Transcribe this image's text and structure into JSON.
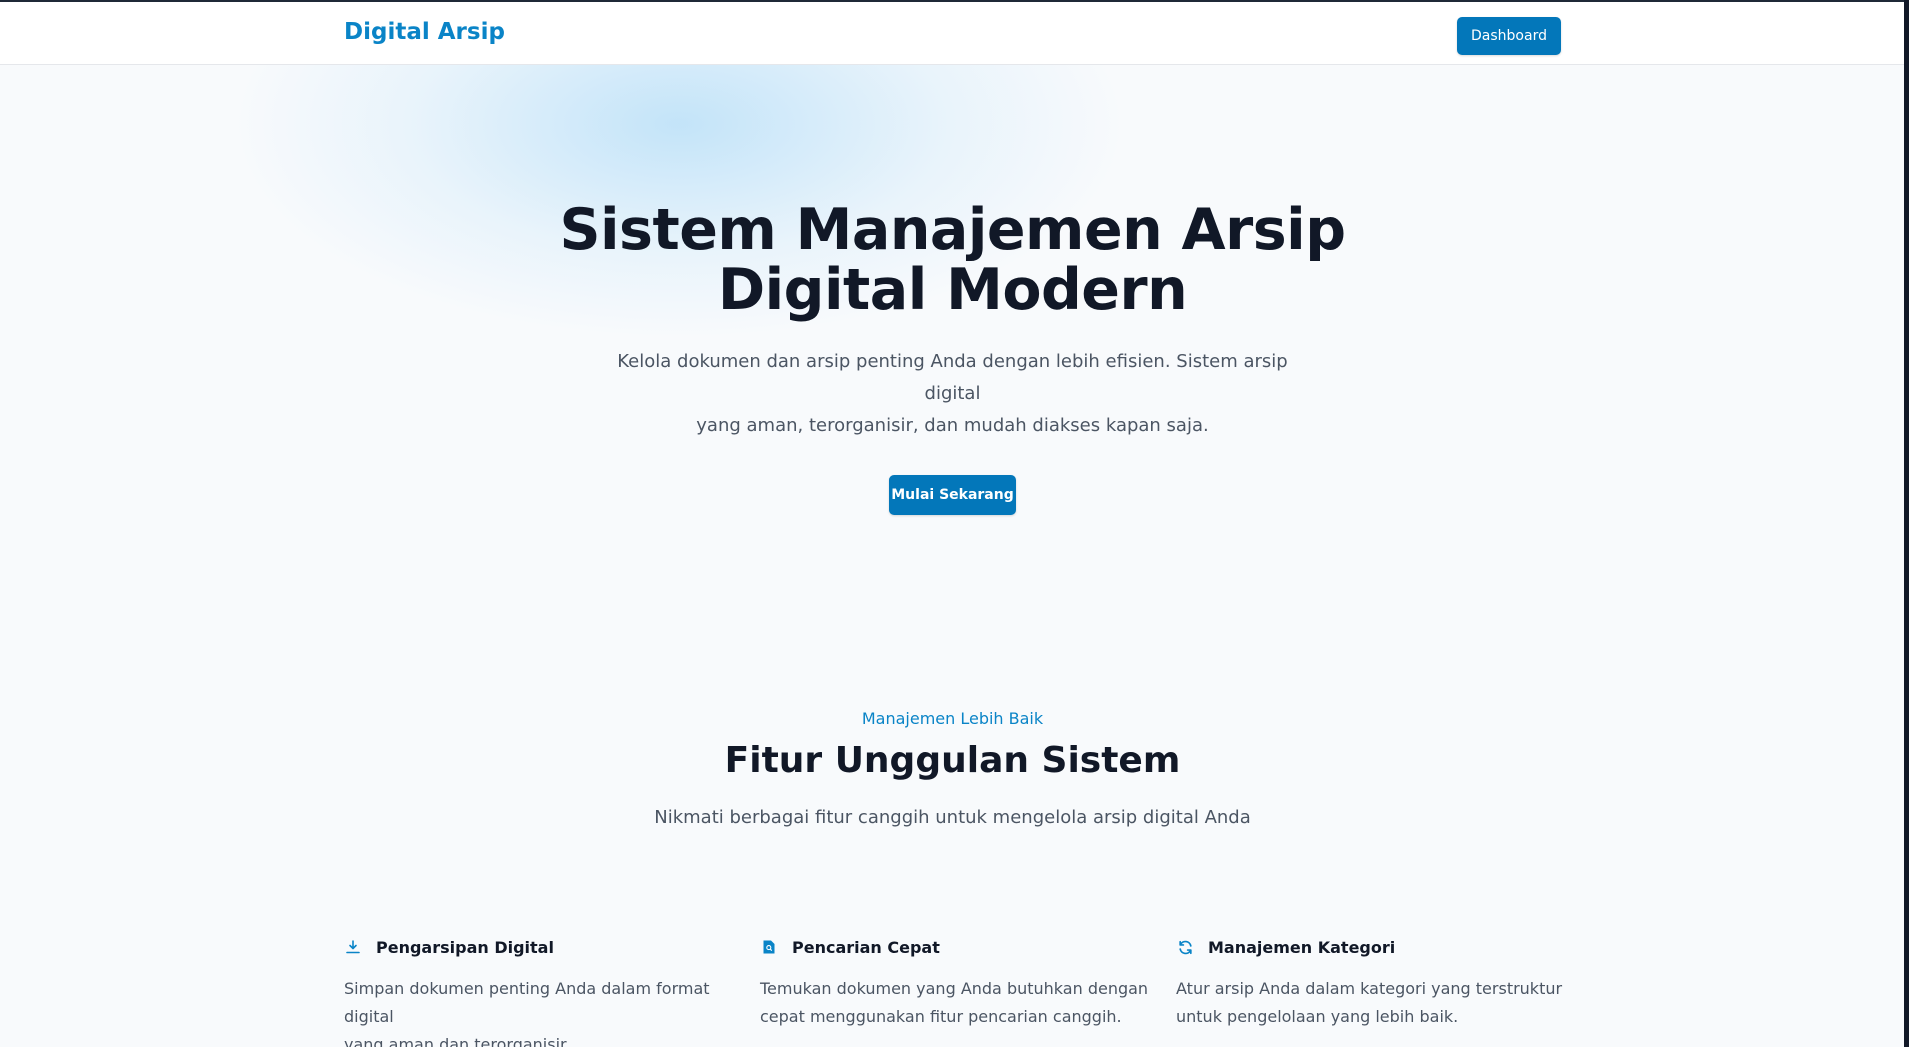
{
  "header": {
    "brand": "Digital Arsip",
    "dashboard_button": "Dashboard"
  },
  "hero": {
    "title_line1": "Sistem Manajemen Arsip",
    "title_line2": "Digital Modern",
    "subtitle_line1": "Kelola dokumen dan arsip penting Anda dengan lebih efisien. Sistem arsip digital",
    "subtitle_line2": "yang aman, terorganisir, dan mudah diakses kapan saja.",
    "cta_label": "Mulai Sekarang"
  },
  "features": {
    "eyebrow": "Manajemen Lebih Baik",
    "title": "Fitur Unggulan Sistem",
    "subtitle": "Nikmati berbagai fitur canggih untuk mengelola arsip digital Anda",
    "items": [
      {
        "icon": "download-tray-icon",
        "title": "Pengarsipan Digital",
        "desc_line1": "Simpan dokumen penting Anda dalam format digital",
        "desc_line2": "yang aman dan terorganisir."
      },
      {
        "icon": "document-search-icon",
        "title": "Pencarian Cepat",
        "desc_line1": "Temukan dokumen yang Anda butuhkan dengan",
        "desc_line2": "cepat menggunakan fitur pencarian canggih."
      },
      {
        "icon": "refresh-icon",
        "title": "Manajemen Kategori",
        "desc_line1": "Atur arsip Anda dalam kategori yang terstruktur",
        "desc_line2": "untuk pengelolaan yang lebih baik."
      }
    ]
  },
  "colors": {
    "accent": "#0a84c7",
    "button": "#0377ba",
    "heading": "#111827",
    "body_text": "#4b5563",
    "background": "#f8fafc"
  }
}
